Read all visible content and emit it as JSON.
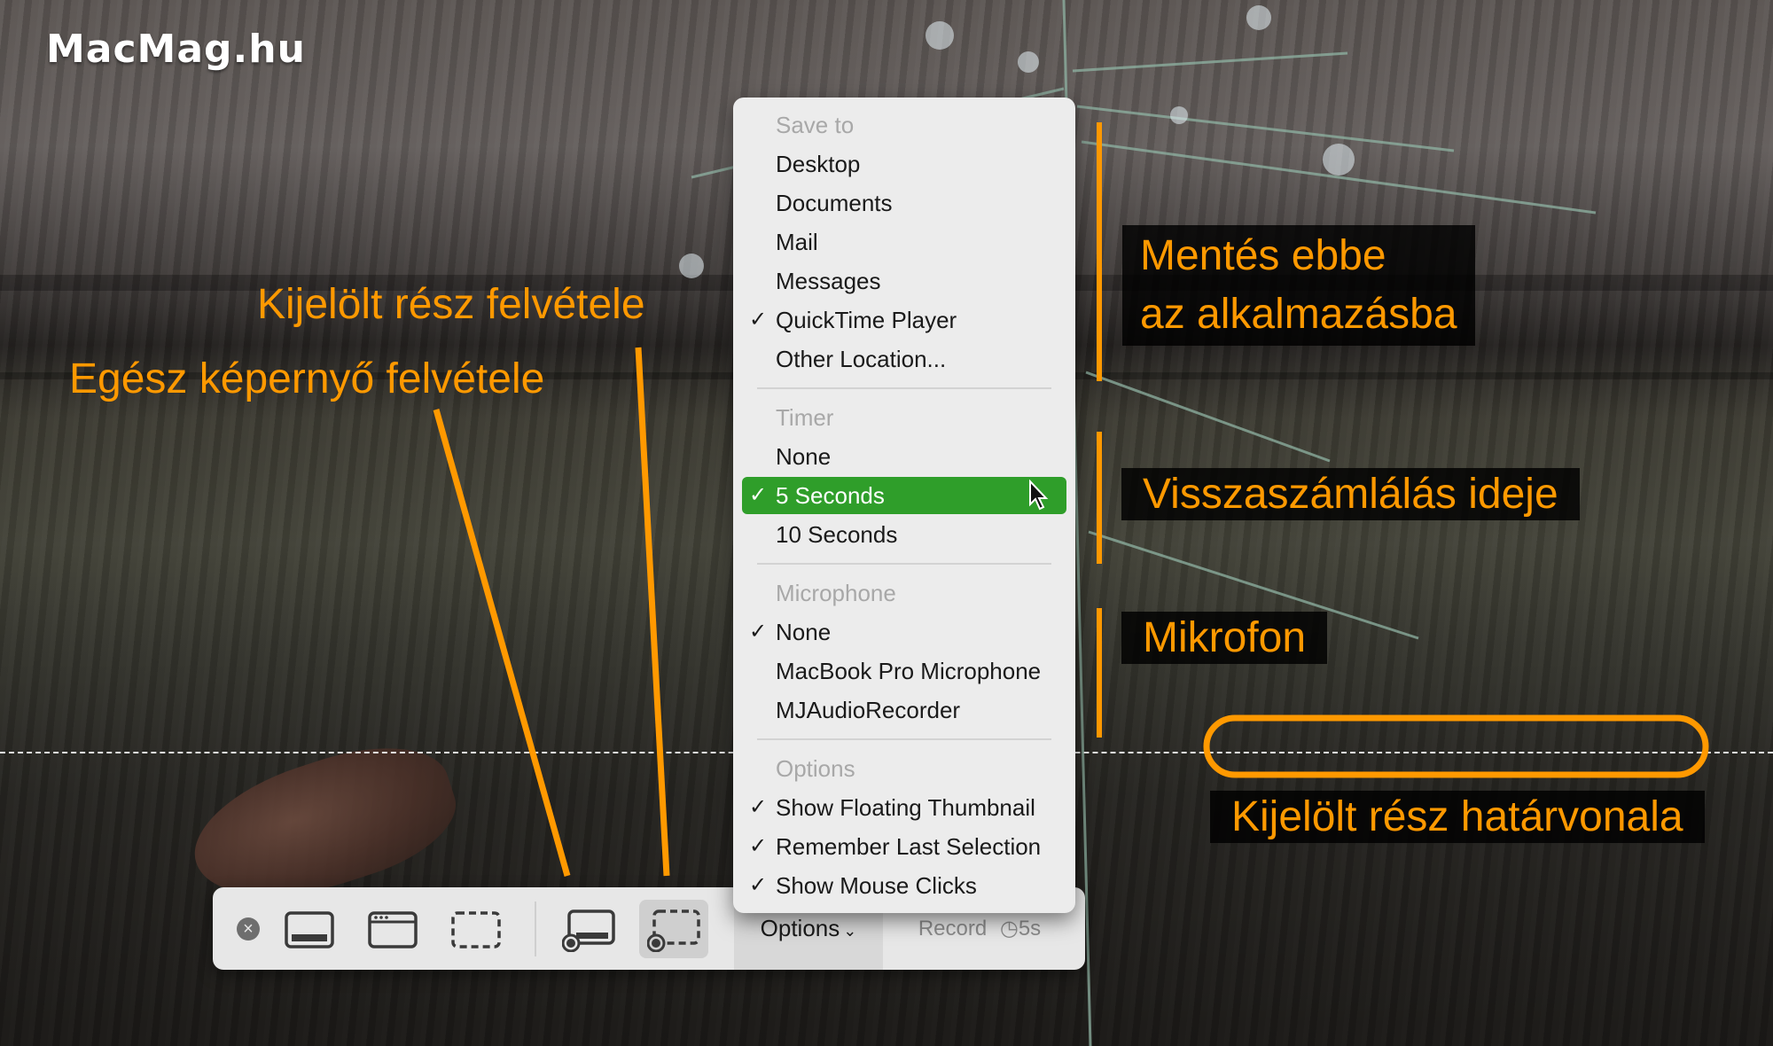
{
  "watermark": "MacMag.hu",
  "toolbar": {
    "options_label": "Options",
    "record_label": "Record",
    "timer_label": "5s"
  },
  "menu": {
    "save_to_header": "Save to",
    "save_to_items": [
      "Desktop",
      "Documents",
      "Mail",
      "Messages",
      "QuickTime Player",
      "Other Location..."
    ],
    "save_to_checked": "QuickTime Player",
    "timer_header": "Timer",
    "timer_items": [
      "None",
      "5 Seconds",
      "10 Seconds"
    ],
    "timer_checked": "5 Seconds",
    "microphone_header": "Microphone",
    "microphone_items": [
      "None",
      "MacBook Pro Microphone",
      "MJAudioRecorder"
    ],
    "microphone_checked": "None",
    "options_header": "Options",
    "options_items": [
      "Show Floating Thumbnail",
      "Remember Last Selection",
      "Show Mouse Clicks"
    ]
  },
  "annotations": {
    "selected_area": "Kijelölt rész felvétele",
    "entire_screen": "Egész képernyő felvétele",
    "save_line1": "Mentés ebbe",
    "save_line2": "az alkalmazásba",
    "countdown": "Visszaszámlálás ideje",
    "microphone": "Mikrofon",
    "selection_border": "Kijelölt rész határvonala"
  },
  "colors": {
    "annotation": "#ff9900",
    "highlight": "#2f9e2a"
  }
}
